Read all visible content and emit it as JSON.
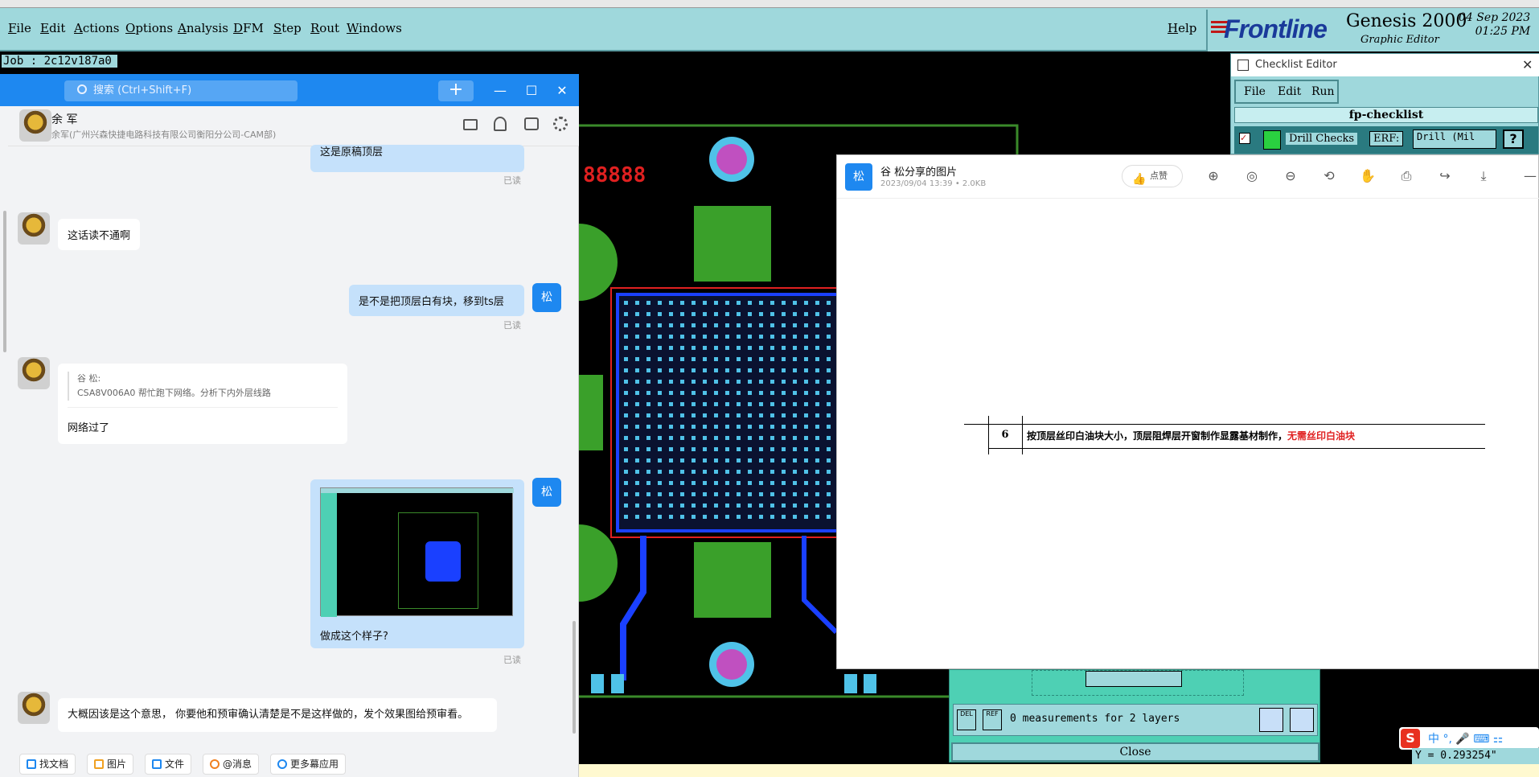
{
  "genesis": {
    "menus": [
      "File",
      "Edit",
      "Actions",
      "Options",
      "Analysis",
      "DFM",
      "Step",
      "Rout",
      "Windows"
    ],
    "help": "Help",
    "brand": "Frontline",
    "product": "Genesis 2000",
    "subtitle": "Graphic Editor",
    "date": "04 Sep 2023",
    "time": "01:25 PM",
    "job": "Job : 2c12v187a0"
  },
  "pcb": {
    "marker_text": "88888"
  },
  "chat": {
    "search_placeholder": "搜索 (Ctrl+Shift+F)",
    "plus": "+",
    "contact_name": "余 军",
    "contact_org": "余军(广州兴森快捷电路科技有限公司衡阳分公司-CAM部)",
    "me_avatar": "松",
    "messages": {
      "m1": "这是原稿顶层",
      "m1_read": "已读",
      "m2": "这话读不通啊",
      "m3": "是不是把顶层白有块，移到ts层",
      "m3_read": "已读",
      "quote_author": "谷 松:",
      "quote_text": "CSA8V006A0 帮忙跑下网络。分析下内外层线路",
      "m4": "网络过了",
      "m5": "做成这个样子?",
      "m5_read": "已读",
      "m6": "大概因该是这个意思， 你要他和预审确认清楚是不是这样做的，发个效果图给预审看。"
    },
    "tools": [
      "找文档",
      "图片",
      "文件",
      "@消息",
      "更多幕应用"
    ]
  },
  "viewer": {
    "avatar": "松",
    "title": "谷 松分享的图片",
    "meta": "2023/09/04 13:39 • 2.0KB",
    "like": "点赞",
    "row_num": "6",
    "row_text": "按顶层丝印白油块大小，顶层阻焊层开窗制作显露基材制作，",
    "row_text_red": "无需丝印白油块",
    "accent": "#1e88f0"
  },
  "checklist": {
    "title": "Checklist Editor",
    "menus": [
      "File",
      "Edit",
      "Run"
    ],
    "name": "fp-checklist",
    "item": "Drill Checks",
    "erf_label": "ERF:",
    "erf_value": "Drill (Mil"
  },
  "measure": {
    "text": "0 measurements for 2 layers",
    "close": "Close",
    "del": "DEL",
    "ref": "REF"
  },
  "coord": "Y = 0.293254\""
}
